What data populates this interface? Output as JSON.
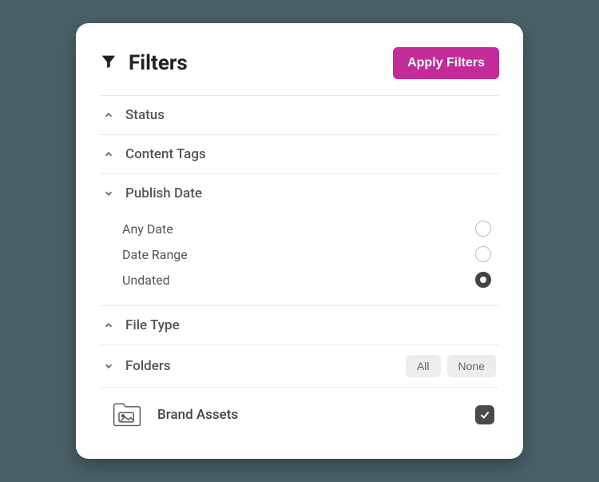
{
  "header": {
    "title": "Filters",
    "apply_label": "Apply Filters"
  },
  "sections": {
    "status": {
      "label": "Status"
    },
    "content_tags": {
      "label": "Content Tags"
    },
    "publish_date": {
      "label": "Publish Date",
      "options": {
        "any_date": "Any Date",
        "date_range": "Date Range",
        "undated": "Undated"
      },
      "selected": "undated"
    },
    "file_type": {
      "label": "File Type"
    },
    "folders": {
      "label": "Folders",
      "all_label": "All",
      "none_label": "None",
      "items": [
        {
          "name": "Brand Assets",
          "checked": true
        }
      ]
    }
  }
}
